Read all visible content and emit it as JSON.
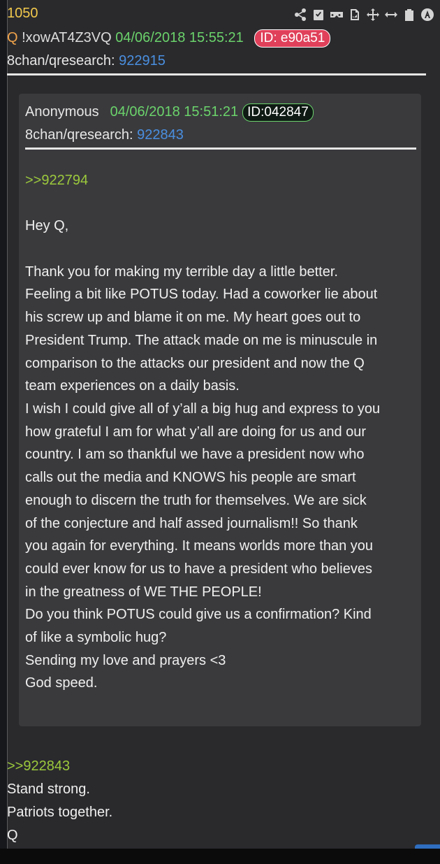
{
  "post": {
    "number": "1050",
    "q_marker": "Q",
    "tripcode": "!xowAT4Z3VQ",
    "date": "04/06/2018 15:55:21",
    "id": "ID: e90a51",
    "board_label": "8chan/qresearch:",
    "post_link": "922915"
  },
  "toolbar": {
    "icons": [
      "share-icon",
      "checkbox-icon",
      "glasses-icon",
      "document-icon",
      "move-icon",
      "resize-icon",
      "clipboard-icon",
      "a-circle-icon"
    ]
  },
  "quoted_post": {
    "author": "Anonymous",
    "date": "04/06/2018 15:51:21",
    "id": "ID:042847",
    "board_label": "8chan/qresearch:",
    "post_link": "922843",
    "reply_ref": ">>922794",
    "greeting": "Hey Q,",
    "lines": [
      "Thank you for making my terrible day a little better.",
      "Feeling a bit like POTUS today. Had a coworker lie about",
      "his screw up and blame it on me. My heart goes out to",
      "President Trump. The attack made on me is minuscule in",
      "comparison to the attacks our president and now the Q",
      "team experiences on a daily basis.",
      "I wish I could give all of y’all a big hug and express to you",
      "how grateful I am for what y’all are doing for us and our",
      "country. I am so thankful we have a president now who",
      "calls out the media and KNOWS his people are smart",
      "enough to discern the truth for themselves. We are sick",
      "of the conjecture and half assed journalism!! So thank",
      "you again for everything. It means worlds more than you",
      "could ever know for us to have a president who believes",
      "in the greatness of WE THE PEOPLE!",
      "Do you think POTUS could give us a confirmation? Kind",
      "of like a symbolic hug?",
      "Sending my love and prayers <3",
      "God speed."
    ]
  },
  "reply": {
    "ref": ">>922843",
    "lines": [
      "Stand strong.",
      "Patriots together.",
      "Q"
    ]
  }
}
